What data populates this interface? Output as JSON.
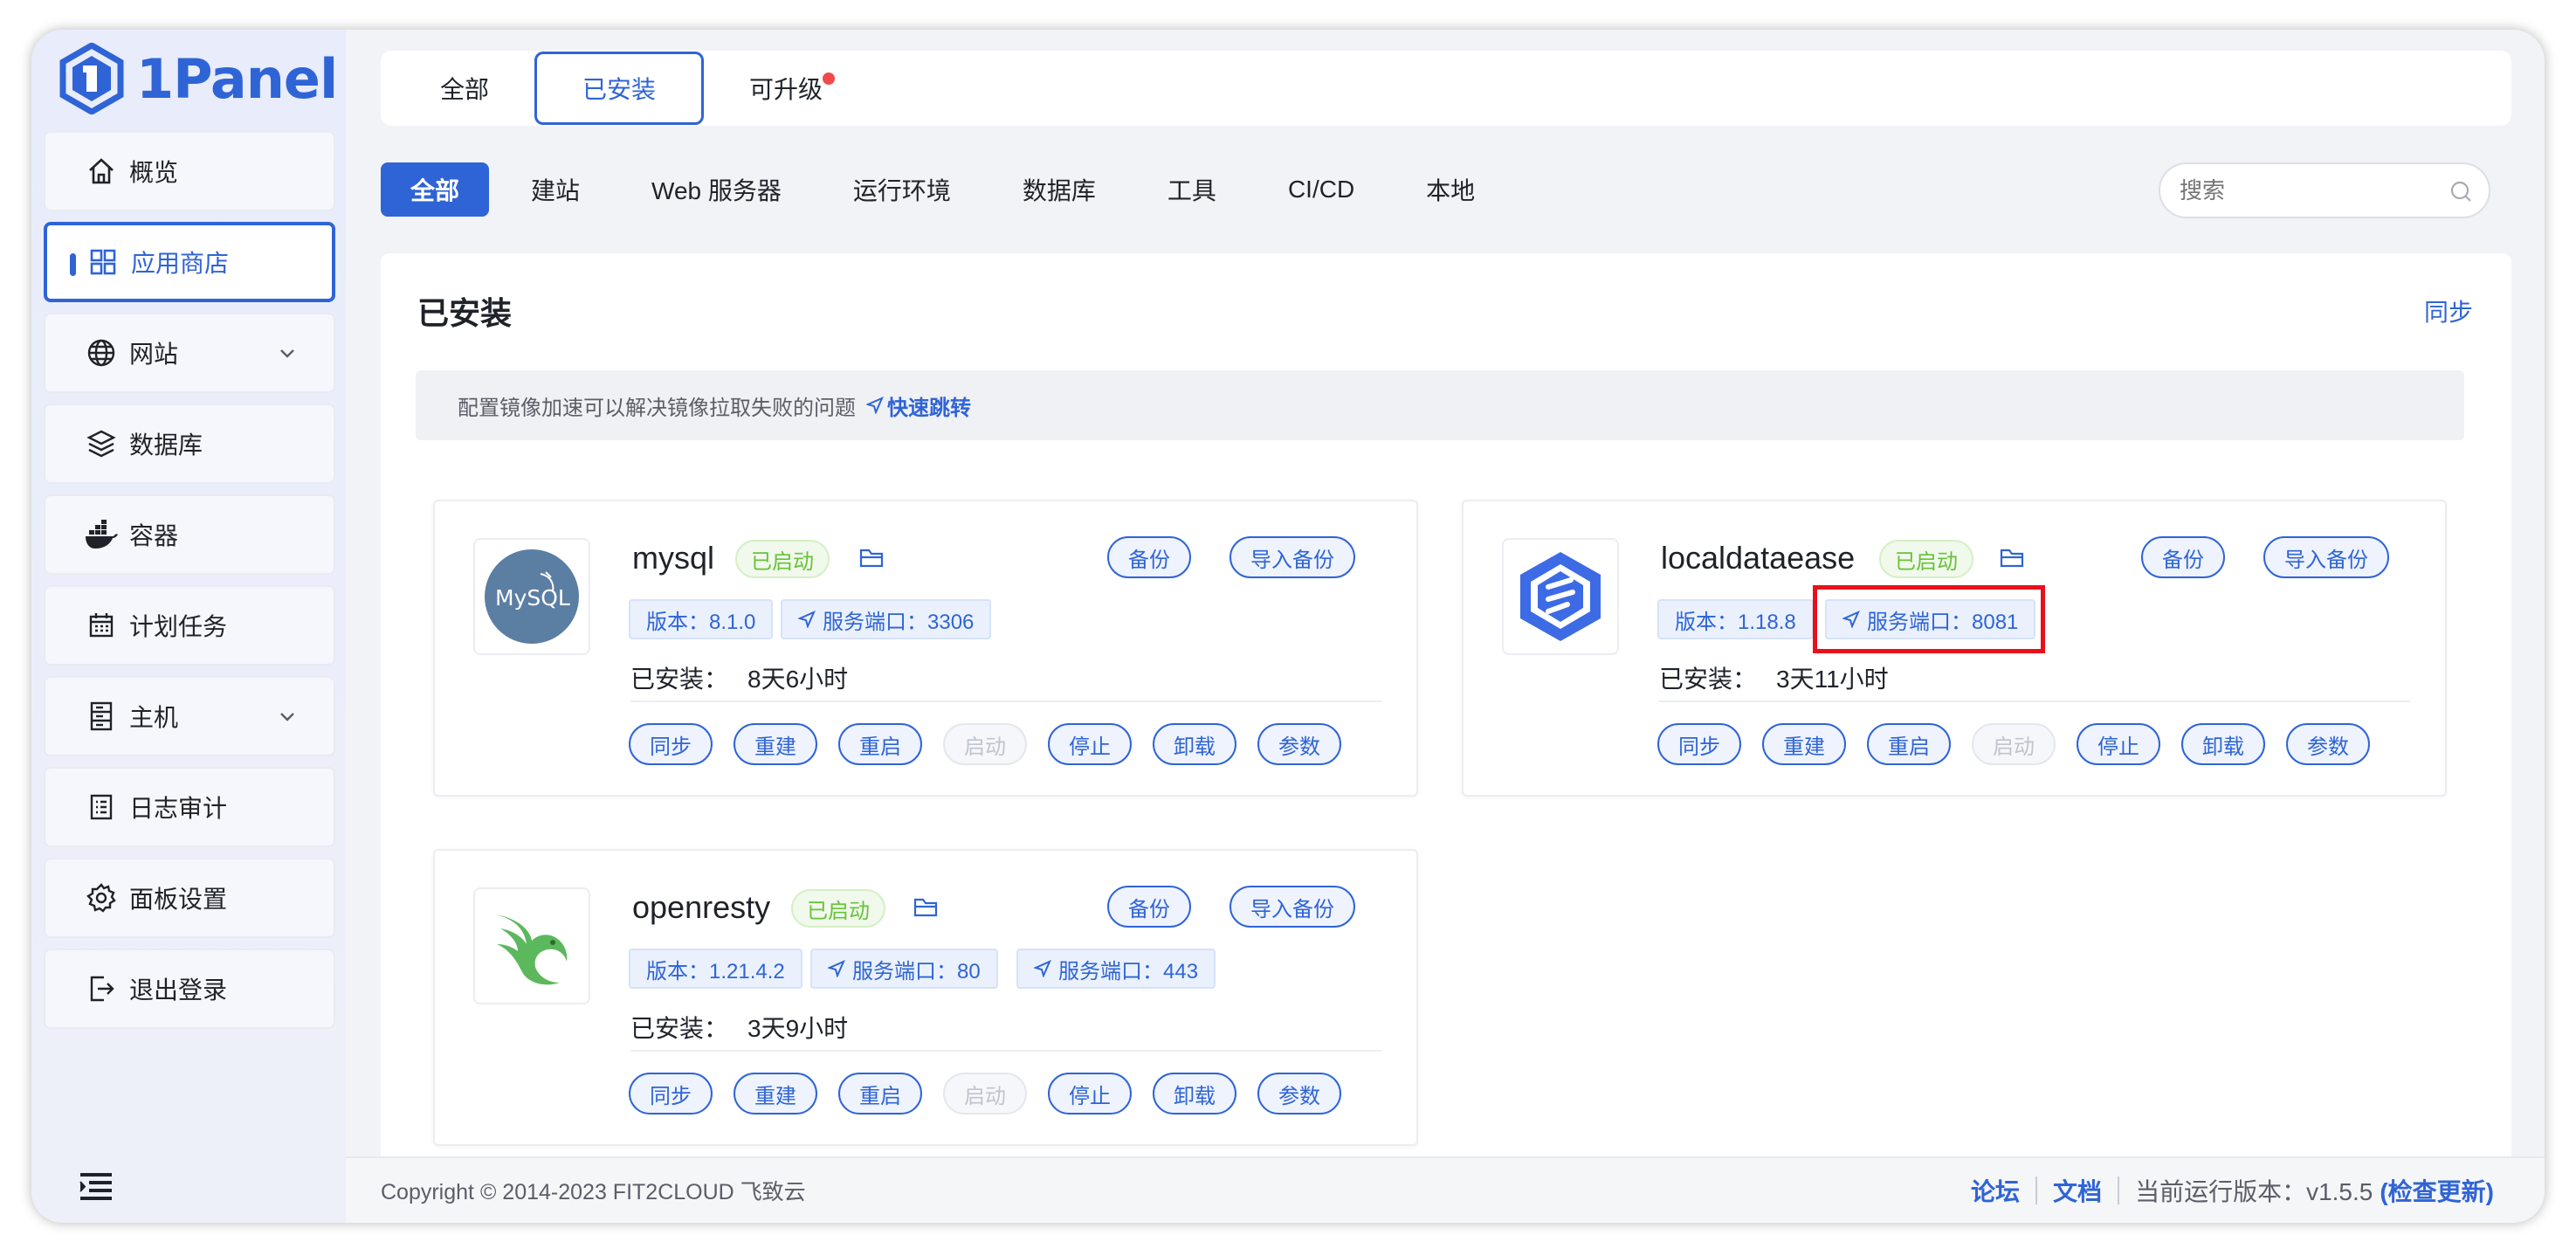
{
  "brand": {
    "name": "1Panel"
  },
  "sidebar": {
    "items": [
      {
        "label": "概览",
        "icon": "home-icon"
      },
      {
        "label": "应用商店",
        "icon": "grid-icon",
        "active": true
      },
      {
        "label": "网站",
        "icon": "globe-icon",
        "expandable": true
      },
      {
        "label": "数据库",
        "icon": "layers-icon"
      },
      {
        "label": "容器",
        "icon": "docker-icon"
      },
      {
        "label": "计划任务",
        "icon": "calendar-icon"
      },
      {
        "label": "主机",
        "icon": "server-icon",
        "expandable": true
      },
      {
        "label": "日志审计",
        "icon": "log-icon"
      },
      {
        "label": "面板设置",
        "icon": "gear-icon"
      },
      {
        "label": "退出登录",
        "icon": "logout-icon"
      }
    ]
  },
  "top_tabs": [
    {
      "label": "全部"
    },
    {
      "label": "已安装",
      "active": true
    },
    {
      "label": "可升级",
      "badge": true
    }
  ],
  "filters": [
    {
      "label": "全部",
      "active": true
    },
    {
      "label": "建站"
    },
    {
      "label": "Web 服务器"
    },
    {
      "label": "运行环境"
    },
    {
      "label": "数据库"
    },
    {
      "label": "工具"
    },
    {
      "label": "CI/CD"
    },
    {
      "label": "本地"
    }
  ],
  "search": {
    "placeholder": "搜索"
  },
  "panel": {
    "title": "已安装",
    "sync_label": "同步",
    "notice_text": "配置镜像加速可以解决镜像拉取失败的问题",
    "notice_link": "快速跳转"
  },
  "apps": [
    {
      "name": "mysql",
      "status": "已启动",
      "backup_label": "备份",
      "import_label": "导入备份",
      "version": "版本：8.1.0",
      "ports": [
        "服务端口：3306"
      ],
      "installed_label": "已安装：",
      "installed_time": "8天6小时",
      "actions": [
        "同步",
        "重建",
        "重启",
        "启动",
        "停止",
        "卸载",
        "参数"
      ]
    },
    {
      "name": "localdataease",
      "status": "已启动",
      "backup_label": "备份",
      "import_label": "导入备份",
      "version": "版本：1.18.8",
      "ports": [
        "服务端口：8081"
      ],
      "installed_label": "已安装：",
      "installed_time": "3天11小时",
      "actions": [
        "同步",
        "重建",
        "重启",
        "启动",
        "停止",
        "卸载",
        "参数"
      ]
    },
    {
      "name": "openresty",
      "status": "已启动",
      "backup_label": "备份",
      "import_label": "导入备份",
      "version": "版本：1.21.4.2",
      "ports": [
        "服务端口：80",
        "服务端口：443"
      ],
      "installed_label": "已安装：",
      "installed_time": "3天9小时",
      "actions": [
        "同步",
        "重建",
        "重启",
        "启动",
        "停止",
        "卸载",
        "参数"
      ]
    }
  ],
  "mysql_logo_text": "MySQL",
  "footer": {
    "copyright": "Copyright © 2014-2023 FIT2CLOUD 飞致云",
    "forum": "论坛",
    "docs": "文档",
    "version_text": "当前运行版本：v1.5.5",
    "check_update": "(检查更新)"
  },
  "colors": {
    "accent": "#2f64d6",
    "success": "#67c23a",
    "highlight": "#e8111b",
    "badge": "#f04a4a"
  }
}
